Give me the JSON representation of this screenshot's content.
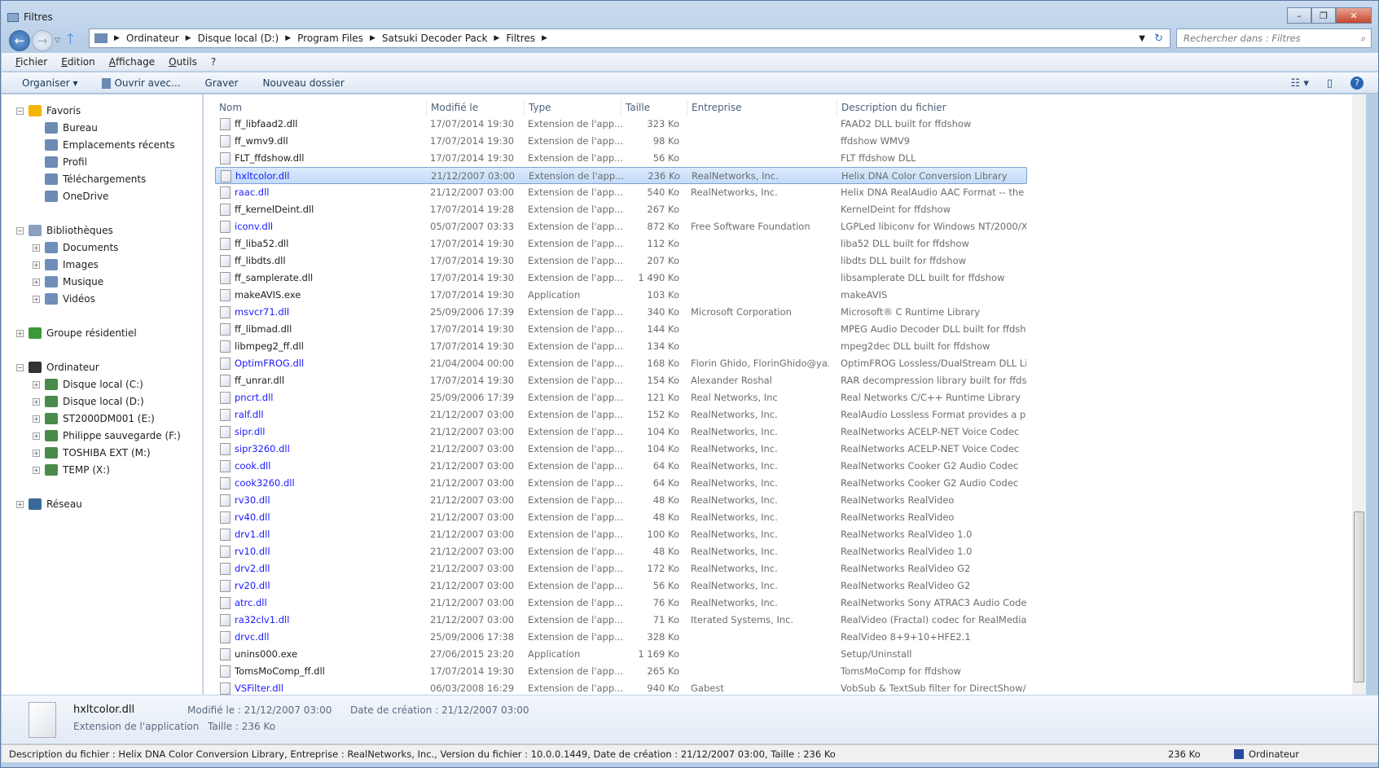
{
  "window": {
    "title": "Filtres",
    "buttons": [
      "minimize",
      "maximize",
      "close"
    ]
  },
  "address": {
    "crumbs": [
      "Ordinateur",
      "Disque local (D:)",
      "Program Files",
      "Satsuki Decoder Pack",
      "Filtres"
    ],
    "search_placeholder": "Rechercher dans : Filtres"
  },
  "menu": [
    "Fichier",
    "Edition",
    "Affichage",
    "Outils",
    "?"
  ],
  "toolbar": {
    "organize": "Organiser ▾",
    "open_with": "Ouvrir avec...",
    "burn": "Graver",
    "new_folder": "Nouveau dossier"
  },
  "nav": {
    "favorites": "Favoris",
    "fav_items": [
      "Bureau",
      "Emplacements récents",
      "Profil",
      "Téléchargements",
      "OneDrive"
    ],
    "libraries": "Bibliothèques",
    "lib_items": [
      "Documents",
      "Images",
      "Musique",
      "Vidéos"
    ],
    "homegroup": "Groupe résidentiel",
    "computer": "Ordinateur",
    "drives": [
      "Disque local (C:)",
      "Disque local (D:)",
      "ST2000DM001 (E:)",
      "Philippe sauvegarde (F:)",
      "TOSHIBA EXT (M:)",
      "TEMP (X:)"
    ],
    "network": "Réseau"
  },
  "columns": [
    "Nom",
    "Modifié le",
    "Type",
    "Taille",
    "Entreprise",
    "Description du fichier"
  ],
  "files": [
    [
      "ff_libfaad2.dll",
      "17/07/2014 19:30",
      "Extension de l'app...",
      "323 Ko",
      "",
      "FAAD2 DLL built for ffdshow",
      false
    ],
    [
      "ff_wmv9.dll",
      "17/07/2014 19:30",
      "Extension de l'app...",
      "98 Ko",
      "",
      "ffdshow WMV9",
      false
    ],
    [
      "FLT_ffdshow.dll",
      "17/07/2014 19:30",
      "Extension de l'app...",
      "56 Ko",
      "",
      "FLT ffdshow DLL",
      false
    ],
    [
      "hxltcolor.dll",
      "21/12/2007 03:00",
      "Extension de l'app...",
      "236 Ko",
      "RealNetworks, Inc.",
      "Helix DNA Color Conversion Library",
      true
    ],
    [
      "raac.dll",
      "21/12/2007 03:00",
      "Extension de l'app...",
      "540 Ko",
      "RealNetworks, Inc.",
      "Helix DNA RealAudio AAC Format -- the ...",
      true
    ],
    [
      "ff_kernelDeint.dll",
      "17/07/2014 19:28",
      "Extension de l'app...",
      "267 Ko",
      "",
      "KernelDeint for ffdshow",
      false
    ],
    [
      "iconv.dll",
      "05/07/2007 03:33",
      "Extension de l'app...",
      "872 Ko",
      "Free Software Foundation",
      "LGPLed libiconv for Windows NT/2000/X...",
      true
    ],
    [
      "ff_liba52.dll",
      "17/07/2014 19:30",
      "Extension de l'app...",
      "112 Ko",
      "",
      "liba52 DLL built for ffdshow",
      false
    ],
    [
      "ff_libdts.dll",
      "17/07/2014 19:30",
      "Extension de l'app...",
      "207 Ko",
      "",
      "libdts DLL built for ffdshow",
      false
    ],
    [
      "ff_samplerate.dll",
      "17/07/2014 19:30",
      "Extension de l'app...",
      "1 490 Ko",
      "",
      "libsamplerate DLL built for ffdshow",
      false
    ],
    [
      "makeAVIS.exe",
      "17/07/2014 19:30",
      "Application",
      "103 Ko",
      "",
      "makeAVIS",
      false
    ],
    [
      "msvcr71.dll",
      "25/09/2006 17:39",
      "Extension de l'app...",
      "340 Ko",
      "Microsoft Corporation",
      "Microsoft® C Runtime Library",
      true
    ],
    [
      "ff_libmad.dll",
      "17/07/2014 19:30",
      "Extension de l'app...",
      "144 Ko",
      "",
      "MPEG Audio Decoder DLL built for ffdsh...",
      false
    ],
    [
      "libmpeg2_ff.dll",
      "17/07/2014 19:30",
      "Extension de l'app...",
      "134 Ko",
      "",
      "mpeg2dec DLL built for ffdshow",
      false
    ],
    [
      "OptimFROG.dll",
      "21/04/2004 00:00",
      "Extension de l'app...",
      "168 Ko",
      "Florin Ghido, FlorinGhido@ya...",
      "OptimFROG Lossless/DualStream DLL Lib...",
      true
    ],
    [
      "ff_unrar.dll",
      "17/07/2014 19:30",
      "Extension de l'app...",
      "154 Ko",
      "Alexander Roshal",
      "RAR decompression library built for ffdsh...",
      false
    ],
    [
      "pncrt.dll",
      "25/09/2006 17:39",
      "Extension de l'app...",
      "121 Ko",
      "Real Networks, Inc",
      "Real Networks C/C++ Runtime Library",
      true
    ],
    [
      "ralf.dll",
      "21/12/2007 03:00",
      "Extension de l'app...",
      "152 Ko",
      "RealNetworks, Inc.",
      "RealAudio Lossless Format provides a per...",
      true
    ],
    [
      "sipr.dll",
      "21/12/2007 03:00",
      "Extension de l'app...",
      "104 Ko",
      "RealNetworks, Inc.",
      "RealNetworks ACELP-NET Voice Codec",
      true
    ],
    [
      "sipr3260.dll",
      "21/12/2007 03:00",
      "Extension de l'app...",
      "104 Ko",
      "RealNetworks, Inc.",
      "RealNetworks ACELP-NET Voice Codec",
      true
    ],
    [
      "cook.dll",
      "21/12/2007 03:00",
      "Extension de l'app...",
      "64 Ko",
      "RealNetworks, Inc.",
      "RealNetworks Cooker G2 Audio Codec",
      true
    ],
    [
      "cook3260.dll",
      "21/12/2007 03:00",
      "Extension de l'app...",
      "64 Ko",
      "RealNetworks, Inc.",
      "RealNetworks Cooker G2 Audio Codec",
      true
    ],
    [
      "rv30.dll",
      "21/12/2007 03:00",
      "Extension de l'app...",
      "48 Ko",
      "RealNetworks, Inc.",
      "RealNetworks RealVideo",
      true
    ],
    [
      "rv40.dll",
      "21/12/2007 03:00",
      "Extension de l'app...",
      "48 Ko",
      "RealNetworks, Inc.",
      "RealNetworks RealVideo",
      true
    ],
    [
      "drv1.dll",
      "21/12/2007 03:00",
      "Extension de l'app...",
      "100 Ko",
      "RealNetworks, Inc.",
      "RealNetworks RealVideo 1.0",
      true
    ],
    [
      "rv10.dll",
      "21/12/2007 03:00",
      "Extension de l'app...",
      "48 Ko",
      "RealNetworks, Inc.",
      "RealNetworks RealVideo 1.0",
      true
    ],
    [
      "drv2.dll",
      "21/12/2007 03:00",
      "Extension de l'app...",
      "172 Ko",
      "RealNetworks, Inc.",
      "RealNetworks RealVideo G2",
      true
    ],
    [
      "rv20.dll",
      "21/12/2007 03:00",
      "Extension de l'app...",
      "56 Ko",
      "RealNetworks, Inc.",
      "RealNetworks RealVideo G2",
      true
    ],
    [
      "atrc.dll",
      "21/12/2007 03:00",
      "Extension de l'app...",
      "76 Ko",
      "RealNetworks, Inc.",
      "RealNetworks Sony ATRAC3 Audio Codec",
      true
    ],
    [
      "ra32clv1.dll",
      "21/12/2007 03:00",
      "Extension de l'app...",
      "71 Ko",
      "Iterated Systems, Inc.",
      "RealVideo (Fractal) codec for RealMedia (...",
      true
    ],
    [
      "drvc.dll",
      "25/09/2006 17:38",
      "Extension de l'app...",
      "328 Ko",
      "",
      "RealVideo 8+9+10+HFE2.1",
      true
    ],
    [
      "unins000.exe",
      "27/06/2015 23:20",
      "Application",
      "1 169 Ko",
      "",
      "Setup/Uninstall",
      false
    ],
    [
      "TomsMoComp_ff.dll",
      "17/07/2014 19:30",
      "Extension de l'app...",
      "265 Ko",
      "",
      "TomsMoComp for ffdshow",
      false
    ],
    [
      "VSFilter.dll",
      "06/03/2008 16:29",
      "Extension de l'app...",
      "940 Ko",
      "Gabest",
      "VobSub & TextSub filter for DirectShow/...",
      true
    ]
  ],
  "selected_index": 3,
  "details": {
    "name": "hxltcolor.dll",
    "type": "Extension de l'application",
    "modified": "Modifié le : 21/12/2007 03:00",
    "created": "Date de création : 21/12/2007 03:00",
    "size": "Taille : 236 Ko"
  },
  "status": {
    "text": "Description du fichier : Helix DNA Color Conversion Library, Entreprise : RealNetworks, Inc., Version du fichier : 10.0.0.1449, Date de création : 21/12/2007 03:00, Taille : 236 Ko",
    "size": "236 Ko",
    "location": "Ordinateur"
  },
  "colors": {
    "selection": "#cce0fa",
    "compressed_name": "#1a1aff"
  }
}
